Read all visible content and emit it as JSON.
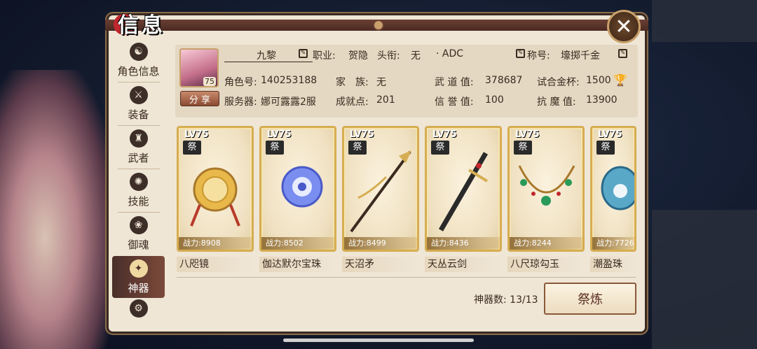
{
  "title": "信息",
  "close_label": "✕",
  "sidenav": [
    {
      "label": "角色信息",
      "icon": "role-icon"
    },
    {
      "label": "装备",
      "icon": "equipment-icon"
    },
    {
      "label": "武者",
      "icon": "warrior-icon"
    },
    {
      "label": "技能",
      "icon": "skill-icon"
    },
    {
      "label": "御魂",
      "icon": "soul-icon"
    },
    {
      "label": "神器",
      "icon": "artifact-icon",
      "active": true
    },
    {
      "label": "",
      "icon": "settings-icon"
    }
  ],
  "player": {
    "name": "九黎",
    "level": "75",
    "job_label": "职业:",
    "job": "贺隐",
    "head_label": "头衔:",
    "head": "无",
    "extra": "· ADC",
    "rank_label": "称号:",
    "rank": "壕掷千金",
    "id_label": "角色号:",
    "id": "140253188",
    "family_label": "家　族:",
    "family": "无",
    "wudao_label": "武 道 值:",
    "wudao": "378687",
    "cup_label": "试合金杯:",
    "cup": "1500",
    "server_label": "服务器:",
    "server": "娜可露露2服",
    "achieve_label": "成就点:",
    "achieve": "201",
    "credit_label": "信 誉 值:",
    "credit": "100",
    "demon_label": "抗 魔 值:",
    "demon": "13900",
    "share_label": "分 享"
  },
  "artifacts": [
    {
      "lv": "LV75",
      "tag": "祭",
      "power": "战力:8908",
      "name": "八咫镜",
      "icon": "mirror-icon"
    },
    {
      "lv": "LV75",
      "tag": "祭",
      "power": "战力:8502",
      "name": "伽达默尔宝珠",
      "icon": "orb-icon"
    },
    {
      "lv": "LV75",
      "tag": "祭",
      "power": "战力:8499",
      "name": "天沼矛",
      "icon": "spear-icon"
    },
    {
      "lv": "LV75",
      "tag": "祭",
      "power": "战力:8436",
      "name": "天丛云剑",
      "icon": "sword-icon"
    },
    {
      "lv": "LV75",
      "tag": "祭",
      "power": "战力:8244",
      "name": "八尺琼勾玉",
      "icon": "necklace-icon"
    },
    {
      "lv": "LV75",
      "tag": "祭",
      "power": "战力:7726",
      "name": "潮盈珠",
      "icon": "pearl-icon"
    }
  ],
  "artifact_count": "神器数: 13/13",
  "refine_label": "祭炼",
  "colors": {
    "accent": "#d6ad52",
    "panel": "#efe6d6",
    "dark": "#3a2a20"
  }
}
